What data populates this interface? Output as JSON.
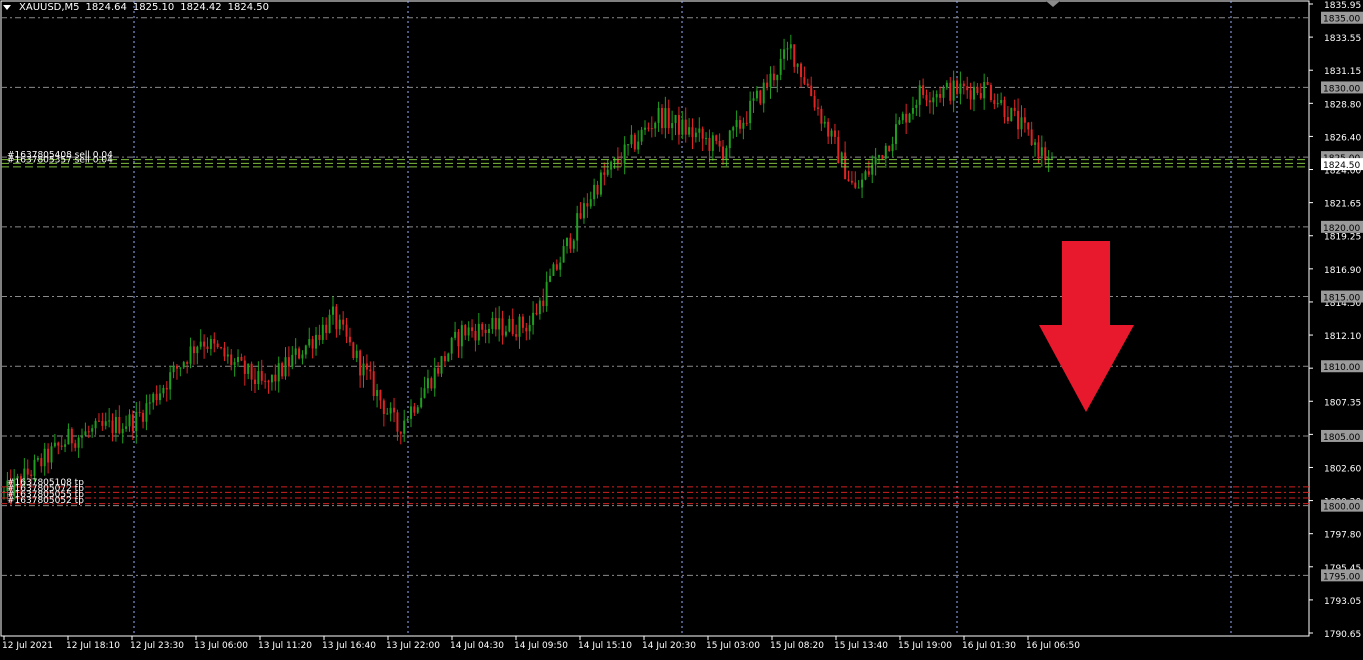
{
  "header": {
    "symbol": "XAUUSD,M5",
    "open": "1824.64",
    "high": "1825.10",
    "low": "1824.42",
    "close": "1824.50"
  },
  "colors": {
    "background": "#000000",
    "bull_candle": "#1f9e1f",
    "bear_candle": "#e02424",
    "grid": "#8a8a8a",
    "session_separator": "#9ab0ff",
    "order_lines": "#7fbf3f",
    "tp_lines": "#d42020",
    "arrow": "#e8192c",
    "axis_text": "#ffffff"
  },
  "price_axis": {
    "min": 1790.65,
    "max": 1836.2,
    "ticks": [
      "1835.95",
      "1833.55",
      "1831.15",
      "1828.80",
      "1826.40",
      "1824.00",
      "1821.65",
      "1819.25",
      "1816.90",
      "1814.50",
      "1812.10",
      "1809.75",
      "1807.35",
      "1804.95",
      "1802.60",
      "1800.20",
      "1797.80",
      "1795.45",
      "1793.05",
      "1790.65"
    ],
    "round_levels": [
      "1835.00",
      "1830.00",
      "1825.00",
      "1820.00",
      "1815.00",
      "1810.00",
      "1805.00",
      "1800.00",
      "1795.00"
    ],
    "current_price": "1824.50"
  },
  "time_axis": {
    "labels": [
      "12 Jul 2021",
      "12 Jul 18:10",
      "12 Jul 23:30",
      "13 Jul 06:00",
      "13 Jul 11:20",
      "13 Jul 16:40",
      "13 Jul 22:00",
      "14 Jul 04:30",
      "14 Jul 09:50",
      "14 Jul 15:10",
      "14 Jul 20:30",
      "15 Jul 03:00",
      "15 Jul 08:20",
      "15 Jul 13:40",
      "15 Jul 19:00",
      "16 Jul 01:30",
      "16 Jul 06:50"
    ]
  },
  "orders": {
    "sell_labels": [
      "#1637805408 sell 0.04",
      "#1637805357 sell 0.04"
    ],
    "sell_prices": [
      1824.82,
      1824.55,
      1824.3
    ],
    "tp_labels": [
      "#1637805108 tp",
      "#1637805072 tp",
      "#1637805055 tp",
      "#1637805052 tp"
    ],
    "tp_prices": [
      1801.35,
      1800.95,
      1800.55,
      1800.15
    ]
  },
  "chart_data": {
    "type": "candlestick",
    "symbol": "XAUUSD",
    "timeframe": "M5",
    "ylim": [
      1790.65,
      1836.2
    ],
    "x": [
      "12 Jul 2021",
      "12 Jul 18:10",
      "12 Jul 23:30",
      "13 Jul 06:00",
      "13 Jul 11:20",
      "13 Jul 16:40",
      "13 Jul 22:00",
      "14 Jul 04:30",
      "14 Jul 09:50",
      "14 Jul 15:10",
      "14 Jul 20:30",
      "15 Jul 03:00",
      "15 Jul 08:20",
      "15 Jul 13:40",
      "15 Jul 19:00",
      "16 Jul 01:30",
      "16 Jul 06:50"
    ],
    "close": [
      1800.8,
      1804.8,
      1806.2,
      1812.0,
      1808.5,
      1813.5,
      1805.5,
      1812.5,
      1813.0,
      1822.8,
      1828.0,
      1825.5,
      1832.8,
      1822.5,
      1829.6,
      1830.0,
      1824.5
    ],
    "high": [
      1804.8,
      1806.9,
      1807.6,
      1813.5,
      1817.0,
      1815.0,
      1809.0,
      1813.5,
      1818.5,
      1830.0,
      1828.8,
      1829.0,
      1834.1,
      1827.2,
      1830.4,
      1832.2,
      1828.2
    ],
    "low": [
      1792.0,
      1802.8,
      1805.0,
      1806.3,
      1799.0,
      1805.3,
      1804.8,
      1806.5,
      1810.0,
      1819.8,
      1824.0,
      1823.3,
      1825.5,
      1820.5,
      1824.0,
      1825.0,
      1823.8
    ]
  },
  "annotation": {
    "arrow_direction": "down"
  }
}
